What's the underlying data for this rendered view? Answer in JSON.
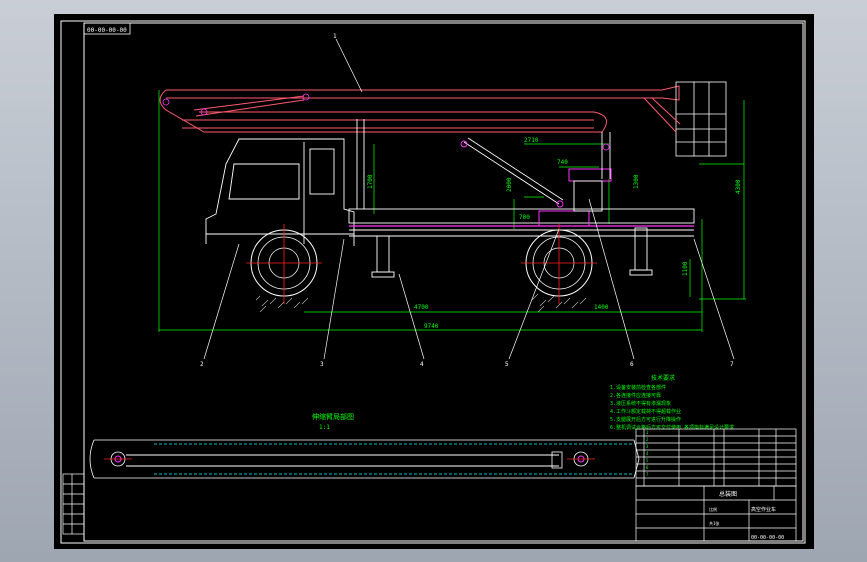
{
  "drawing": {
    "corner_code": "00-00-00-00",
    "top_callout": "1",
    "bottom_callouts": [
      "2",
      "3",
      "4",
      "5",
      "6",
      "7"
    ],
    "dims": {
      "overall_length": "9740",
      "wheelbase": "4700",
      "rear_overhang": "1400",
      "upper_span": "2710",
      "turntable_width": "740",
      "base_width": "700",
      "cyl_height": "2000",
      "post_height": "1300",
      "cab_height": "1700",
      "total_height": "4300",
      "ground_height": "1100"
    },
    "section_title": "伸缩臂局部图",
    "section_scale": "1:1",
    "notes_title": "技术要求",
    "notes": [
      "1.设备安装前检查各部件",
      "2.各连接件应连接可靠",
      "3.液压系统不得有渗漏现象",
      "4.工作斗额定载荷不得超载作业",
      "5.支腿展开后方可进行升降操作",
      "6.整机调试合格后方可交付使用 各项指标满足设计要求"
    ],
    "title_block": {
      "drawing_name": "总装图",
      "part_no": "00-00-00-00",
      "company": "高空作业车",
      "scale_label": "比例",
      "sheet_label": "共1张"
    }
  },
  "colors": {
    "background": "#000000",
    "frame": "#ffffff",
    "boom": "#ff5a6e",
    "magenta": "#ff33ff",
    "dimension": "#00ff00",
    "cyan": "#00ffff",
    "centerline": "#ff2020",
    "yellow": "#ffff00",
    "hatch": "#c0c0c0"
  }
}
